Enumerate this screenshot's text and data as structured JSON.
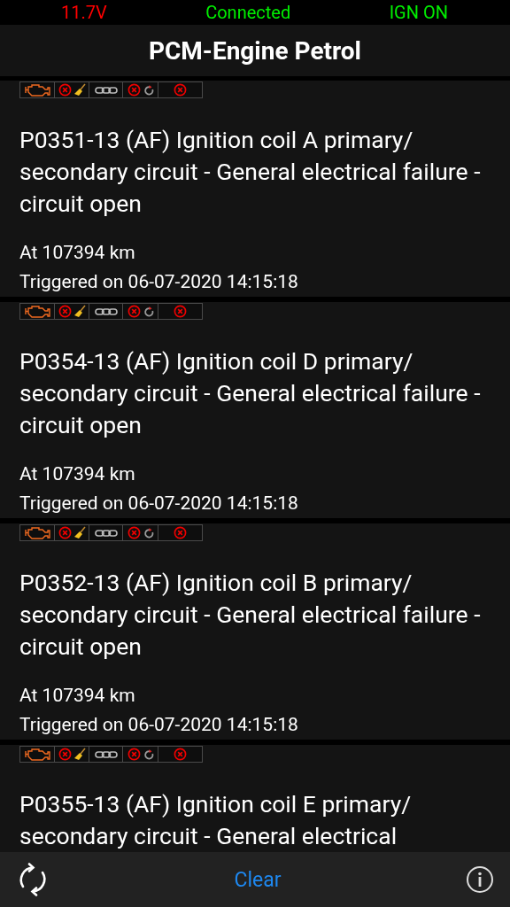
{
  "status_bar": {
    "voltage": "11.7V",
    "connection": "Connected",
    "ignition": "IGN ON"
  },
  "header": {
    "title": "PCM-Engine Petrol"
  },
  "faults": [
    {
      "title": "P0351-13 (AF) Ignition coil A primary/ secondary circuit - General electrical failure - circuit open",
      "mileage": "At 107394 km",
      "triggered": "Triggered on 06-07-2020 14:15:18"
    },
    {
      "title": "P0354-13 (AF) Ignition coil D primary/ secondary circuit - General electrical failure - circuit open",
      "mileage": "At 107394 km",
      "triggered": "Triggered on 06-07-2020 14:15:18"
    },
    {
      "title": "P0352-13 (AF) Ignition coil B primary/ secondary circuit - General electrical failure - circuit open",
      "mileage": "At 107394 km",
      "triggered": "Triggered on 06-07-2020 14:15:18"
    },
    {
      "title": "P0355-13 (AF) Ignition coil E primary/ secondary circuit - General electrical"
    }
  ],
  "toolbar": {
    "clear": "Clear"
  }
}
